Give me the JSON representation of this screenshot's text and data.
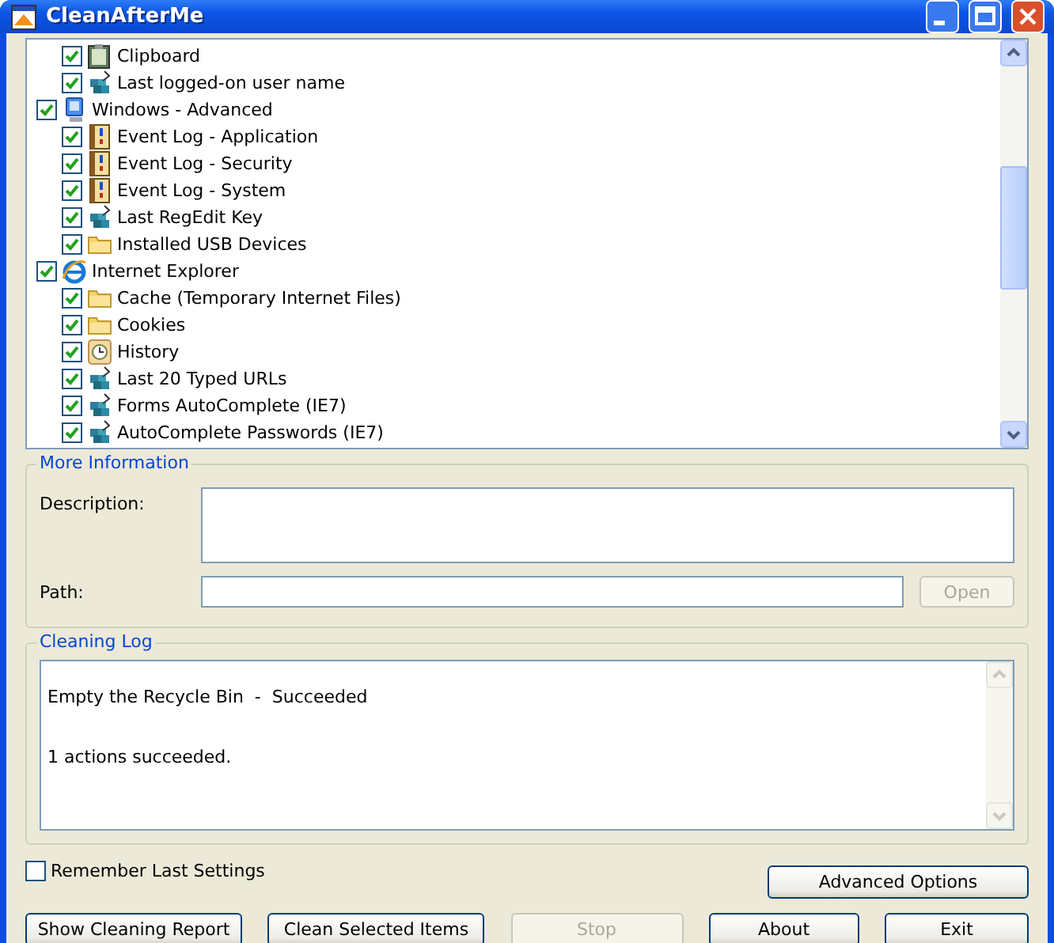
{
  "window": {
    "title": "CleanAfterMe"
  },
  "tree": {
    "groups": [
      {
        "items": [
          {
            "label": "Clipboard",
            "kind": "clipboard",
            "checked": true
          },
          {
            "label": "Last logged-on user name",
            "kind": "registry",
            "checked": true
          }
        ]
      },
      {
        "label": "Windows - Advanced",
        "kind": "computer",
        "checked": true,
        "items": [
          {
            "label": "Event Log - Application",
            "kind": "log",
            "checked": true
          },
          {
            "label": "Event Log - Security",
            "kind": "log",
            "checked": true
          },
          {
            "label": "Event Log - System",
            "kind": "log",
            "checked": true
          },
          {
            "label": "Last RegEdit Key",
            "kind": "registry",
            "checked": true
          },
          {
            "label": "Installed USB Devices",
            "kind": "folder",
            "checked": true
          }
        ]
      },
      {
        "label": "Internet Explorer",
        "kind": "browser",
        "checked": true,
        "items": [
          {
            "label": "Cache (Temporary Internet Files)",
            "kind": "folder",
            "checked": true
          },
          {
            "label": "Cookies",
            "kind": "folder",
            "checked": true
          },
          {
            "label": "History",
            "kind": "history",
            "checked": true
          },
          {
            "label": "Last 20 Typed URLs",
            "kind": "registry",
            "checked": true
          },
          {
            "label": "Forms AutoComplete (IE7)",
            "kind": "registry",
            "checked": true
          },
          {
            "label": "AutoComplete Passwords  (IE7)",
            "kind": "registry",
            "checked": true
          }
        ]
      }
    ]
  },
  "more_information": {
    "title": "More Information",
    "description_label": "Description:",
    "path_label": "Path:",
    "open_button": {
      "label": "Open",
      "disabled": true
    }
  },
  "cleaning_log": {
    "title": "Cleaning Log",
    "lines": [
      "Empty the Recycle Bin  -  Succeeded",
      "1 actions succeeded."
    ]
  },
  "remember_settings": {
    "label": "Remember Last Settings",
    "checked": false
  },
  "advanced_button": {
    "label": "Advanced Options",
    "disabled": false
  },
  "buttons": [
    {
      "label": "Show Cleaning Report",
      "disabled": false
    },
    {
      "label": "Clean Selected Items",
      "disabled": false
    },
    {
      "label": "Stop",
      "disabled": true
    },
    {
      "label": "About",
      "disabled": false
    },
    {
      "label": "Exit",
      "disabled": false
    }
  ]
}
